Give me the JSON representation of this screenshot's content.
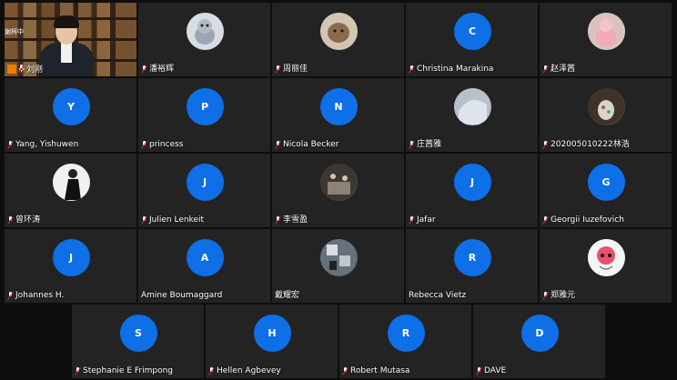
{
  "participants": {
    "self_video": {
      "name": "刘刚",
      "overlay_label": "谢柯中"
    },
    "row1": [
      {
        "name": "潘裕辉"
      },
      {
        "name": "周丽佳"
      },
      {
        "initial": "C",
        "name": "Christina Marakina"
      },
      {
        "name": "赵泽茜"
      }
    ],
    "row2": [
      {
        "initial": "Y",
        "name": "Yang, Yishuwen"
      },
      {
        "initial": "P",
        "name": "princess"
      },
      {
        "initial": "N",
        "name": "Nicola Becker"
      },
      {
        "name": "庄茜雅"
      },
      {
        "name": "202005010222林浩"
      }
    ],
    "row3": [
      {
        "name": "曾环涛"
      },
      {
        "initial": "J",
        "name": "Julien Lenkeit"
      },
      {
        "name": "李雪盈"
      },
      {
        "initial": "J",
        "name": "Jafar"
      },
      {
        "initial": "G",
        "name": "Georgii Iuzefovich"
      }
    ],
    "row4": [
      {
        "initial": "J",
        "name": "Johannes H."
      },
      {
        "initial": "A",
        "name": "Amine Boumaggard"
      },
      {
        "name": "戴耀宏"
      },
      {
        "initial": "R",
        "name": "Rebecca Vietz"
      },
      {
        "name": "郑雅元"
      }
    ],
    "row5": [
      {
        "initial": "S",
        "name": "Stephanie E Frimpong"
      },
      {
        "initial": "H",
        "name": "Hellen Agbevey"
      },
      {
        "initial": "R",
        "name": "Robert Mutasa"
      },
      {
        "initial": "D",
        "name": "DAVE"
      }
    ]
  },
  "icons": {
    "mic_muted": "mic-muted-icon",
    "video_badge": "self-video-badge-icon"
  },
  "colors": {
    "tile_bg": "#232323",
    "page_bg": "#0e0e0e",
    "avatar_blue": "#0e6fe6",
    "text": "#ffffff"
  }
}
